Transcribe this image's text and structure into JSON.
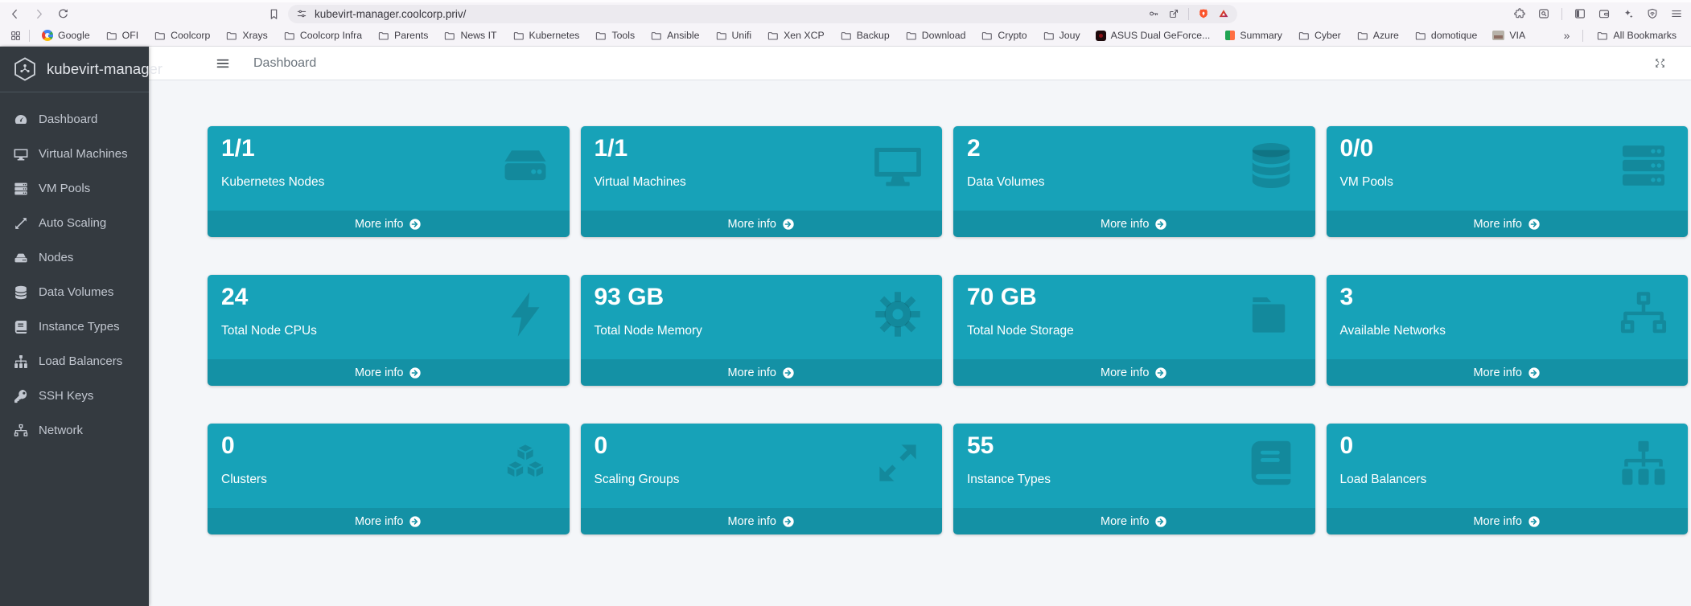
{
  "browser": {
    "toolbar": {
      "url": "kubevirt-manager.coolcorp.priv/"
    },
    "bookmarks_bar": {
      "items": [
        {
          "label": "Google",
          "icon": "google"
        },
        {
          "label": "OFI",
          "icon": "folder"
        },
        {
          "label": "Coolcorp",
          "icon": "folder"
        },
        {
          "label": "Xrays",
          "icon": "folder"
        },
        {
          "label": "Coolcorp Infra",
          "icon": "folder"
        },
        {
          "label": "Parents",
          "icon": "folder"
        },
        {
          "label": "News IT",
          "icon": "folder"
        },
        {
          "label": "Kubernetes",
          "icon": "folder"
        },
        {
          "label": "Tools",
          "icon": "folder"
        },
        {
          "label": "Ansible",
          "icon": "folder"
        },
        {
          "label": "Unifi",
          "icon": "folder"
        },
        {
          "label": "Xen XCP",
          "icon": "folder"
        },
        {
          "label": "Backup",
          "icon": "folder"
        },
        {
          "label": "Download",
          "icon": "folder"
        },
        {
          "label": "Crypto",
          "icon": "folder"
        },
        {
          "label": "Jouy",
          "icon": "folder"
        },
        {
          "label": "ASUS Dual GeForce...",
          "icon": "asus"
        },
        {
          "label": "Summary",
          "icon": "summary"
        },
        {
          "label": "Cyber",
          "icon": "folder"
        },
        {
          "label": "Azure",
          "icon": "folder"
        },
        {
          "label": "domotique",
          "icon": "folder"
        },
        {
          "label": "VIA",
          "icon": "via"
        }
      ],
      "overflow_glyph": "»",
      "all_bookmarks_label": "All Bookmarks"
    }
  },
  "app": {
    "sidebar": {
      "brand": "kubevirt-manager",
      "items": [
        {
          "label": "Dashboard",
          "icon": "tachometer"
        },
        {
          "label": "Virtual Machines",
          "icon": "desktop"
        },
        {
          "label": "VM Pools",
          "icon": "server-rack"
        },
        {
          "label": "Auto Scaling",
          "icon": "scale-arrows"
        },
        {
          "label": "Nodes",
          "icon": "hdd"
        },
        {
          "label": "Data Volumes",
          "icon": "database"
        },
        {
          "label": "Instance Types",
          "icon": "book"
        },
        {
          "label": "Load Balancers",
          "icon": "sitemap"
        },
        {
          "label": "SSH Keys",
          "icon": "key"
        },
        {
          "label": "Network",
          "icon": "network"
        }
      ]
    },
    "topbar": {
      "title": "Dashboard"
    },
    "cards": {
      "more_info_label": "More info",
      "items": [
        {
          "value": "1/1",
          "label": "Kubernetes Nodes",
          "icon": "server"
        },
        {
          "value": "1/1",
          "label": "Virtual Machines",
          "icon": "desktop"
        },
        {
          "value": "2",
          "label": "Data Volumes",
          "icon": "database"
        },
        {
          "value": "0/0",
          "label": "VM Pools",
          "icon": "server-rack"
        },
        {
          "value": "24",
          "label": "Total Node CPUs",
          "icon": "bolt"
        },
        {
          "value": "93 GB",
          "label": "Total Node Memory",
          "icon": "gear"
        },
        {
          "value": "70 GB",
          "label": "Total Node Storage",
          "icon": "folder-fill"
        },
        {
          "value": "3",
          "label": "Available Networks",
          "icon": "network"
        },
        {
          "value": "0",
          "label": "Clusters",
          "icon": "cubes"
        },
        {
          "value": "0",
          "label": "Scaling Groups",
          "icon": "expand-arrows"
        },
        {
          "value": "55",
          "label": "Instance Types",
          "icon": "book"
        },
        {
          "value": "0",
          "label": "Load Balancers",
          "icon": "sitemap"
        }
      ]
    },
    "colors": {
      "card_teal": "#17a2b8",
      "sidebar_dark": "#343a40",
      "page_bg": "#f4f6f9",
      "brave_orange": "#fb542b"
    }
  }
}
